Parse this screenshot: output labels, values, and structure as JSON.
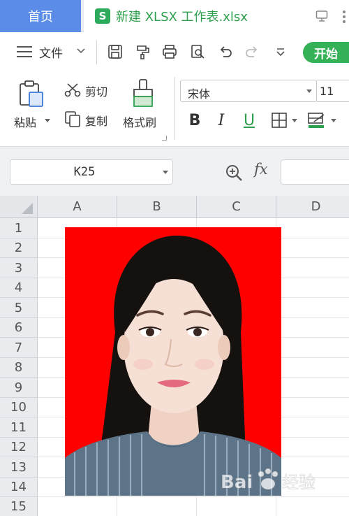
{
  "tabs": {
    "home_label": "首页",
    "file_label": "新建 XLSX 工作表.xlsx",
    "file_icon_letter": "S"
  },
  "menu": {
    "file_label": "文件",
    "start_label": "开始",
    "quick_access_icons": [
      "save-icon",
      "format-painter-quick-icon",
      "print-icon",
      "print-preview-icon",
      "undo-icon",
      "redo-icon",
      "more-dropdown-icon"
    ]
  },
  "ribbon": {
    "paste_label": "粘贴",
    "cut_label": "剪切",
    "copy_label": "复制",
    "format_painter_label": "格式刷",
    "font_name": "宋体",
    "font_size": "11",
    "bold_label": "B",
    "italic_label": "I",
    "underline_label": "U"
  },
  "formula_bar": {
    "cell_reference": "K25",
    "fx_label": "fx",
    "formula_value": ""
  },
  "sheet": {
    "columns": [
      "A",
      "B",
      "C",
      "D"
    ],
    "rows": [
      "1",
      "2",
      "3",
      "4",
      "5",
      "6",
      "7",
      "8",
      "9",
      "10",
      "11",
      "12",
      "13",
      "14",
      "15"
    ]
  },
  "image": {
    "description_icon": "id-photo",
    "background_color": "#ff0000"
  },
  "watermark": {
    "text": "Bai 经验",
    "logo": "baidu-paw-logo"
  },
  "colors": {
    "accent_blue": "#5b8de8",
    "accent_green": "#35b158",
    "file_tab_text": "#2ea04e"
  }
}
